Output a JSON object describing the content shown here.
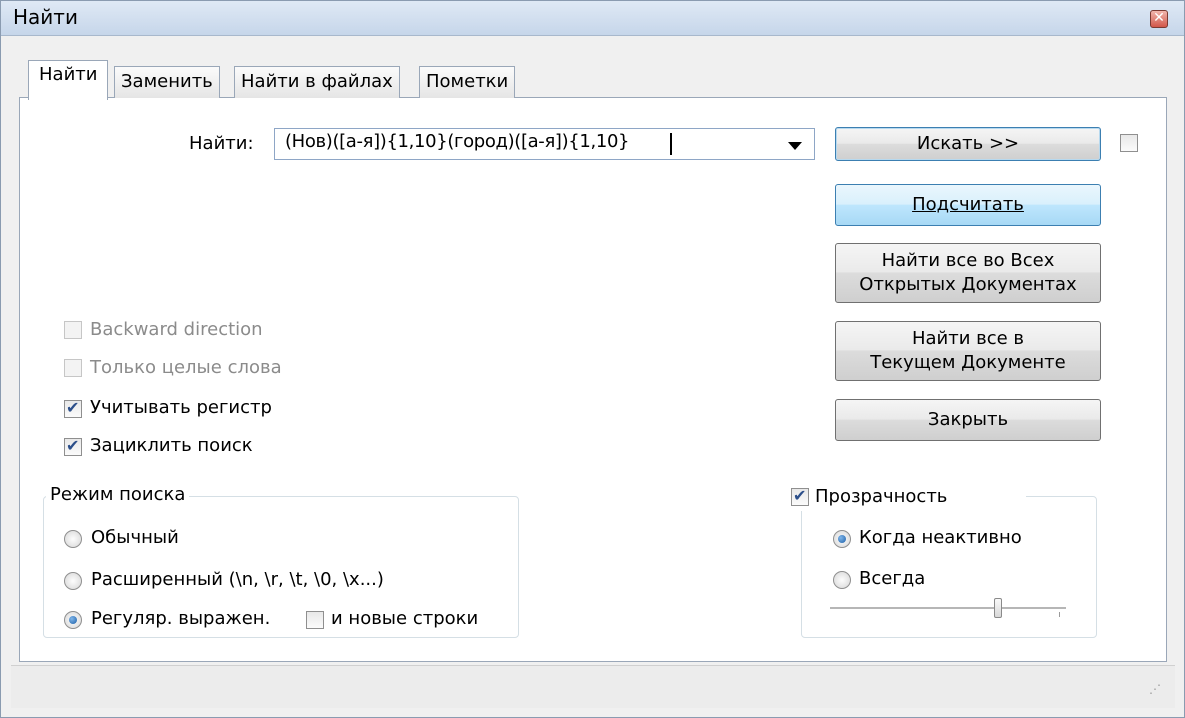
{
  "window": {
    "title": "Найти"
  },
  "tabs": [
    "Найти",
    "Заменить",
    "Найти в файлах",
    "Пометки"
  ],
  "find": {
    "label": "Найти:",
    "value": "(Нов)([а-я]){1,10}(город)([а-я]){1,10}"
  },
  "buttons": {
    "search": "Искать >>",
    "count": "Подсчитать",
    "find_all_open_line1": "Найти все во Всех",
    "find_all_open_line2": "Открытых Документах",
    "find_all_current_line1": "Найти все в",
    "find_all_current_line2": "Текущем Документе",
    "close": "Закрыть"
  },
  "options": {
    "backward_direction": {
      "label": "Backward direction",
      "checked": false,
      "disabled": true
    },
    "whole_words": {
      "label": "Только целые слова",
      "checked": false,
      "disabled": true
    },
    "match_case": {
      "label": "Учитывать регистр",
      "checked": true
    },
    "wrap_around": {
      "label": "Зациклить поиск",
      "checked": true
    }
  },
  "search_mode": {
    "legend": "Режим поиска",
    "normal": "Обычный",
    "extended": "Расширенный (\\n, \\r, \\t, \\0, \\x...)",
    "regex": "Регуляр. выражен.",
    "selected": "regex",
    "newlines_label": "и новые строки",
    "newlines_checked": false
  },
  "transparency": {
    "label": "Прозрачность",
    "checked": true,
    "when_inactive": "Когда неактивно",
    "always": "Всегда",
    "selected": "when_inactive",
    "slider_level": 0.7
  },
  "icons": {
    "close": "close-icon",
    "dropdown": "chevron-down-icon",
    "resize": "resize-grip-icon"
  },
  "colors": {
    "title_bar": "#c6d6ea",
    "button_hover": "#bee6fd",
    "close_button": "#d2574a"
  }
}
